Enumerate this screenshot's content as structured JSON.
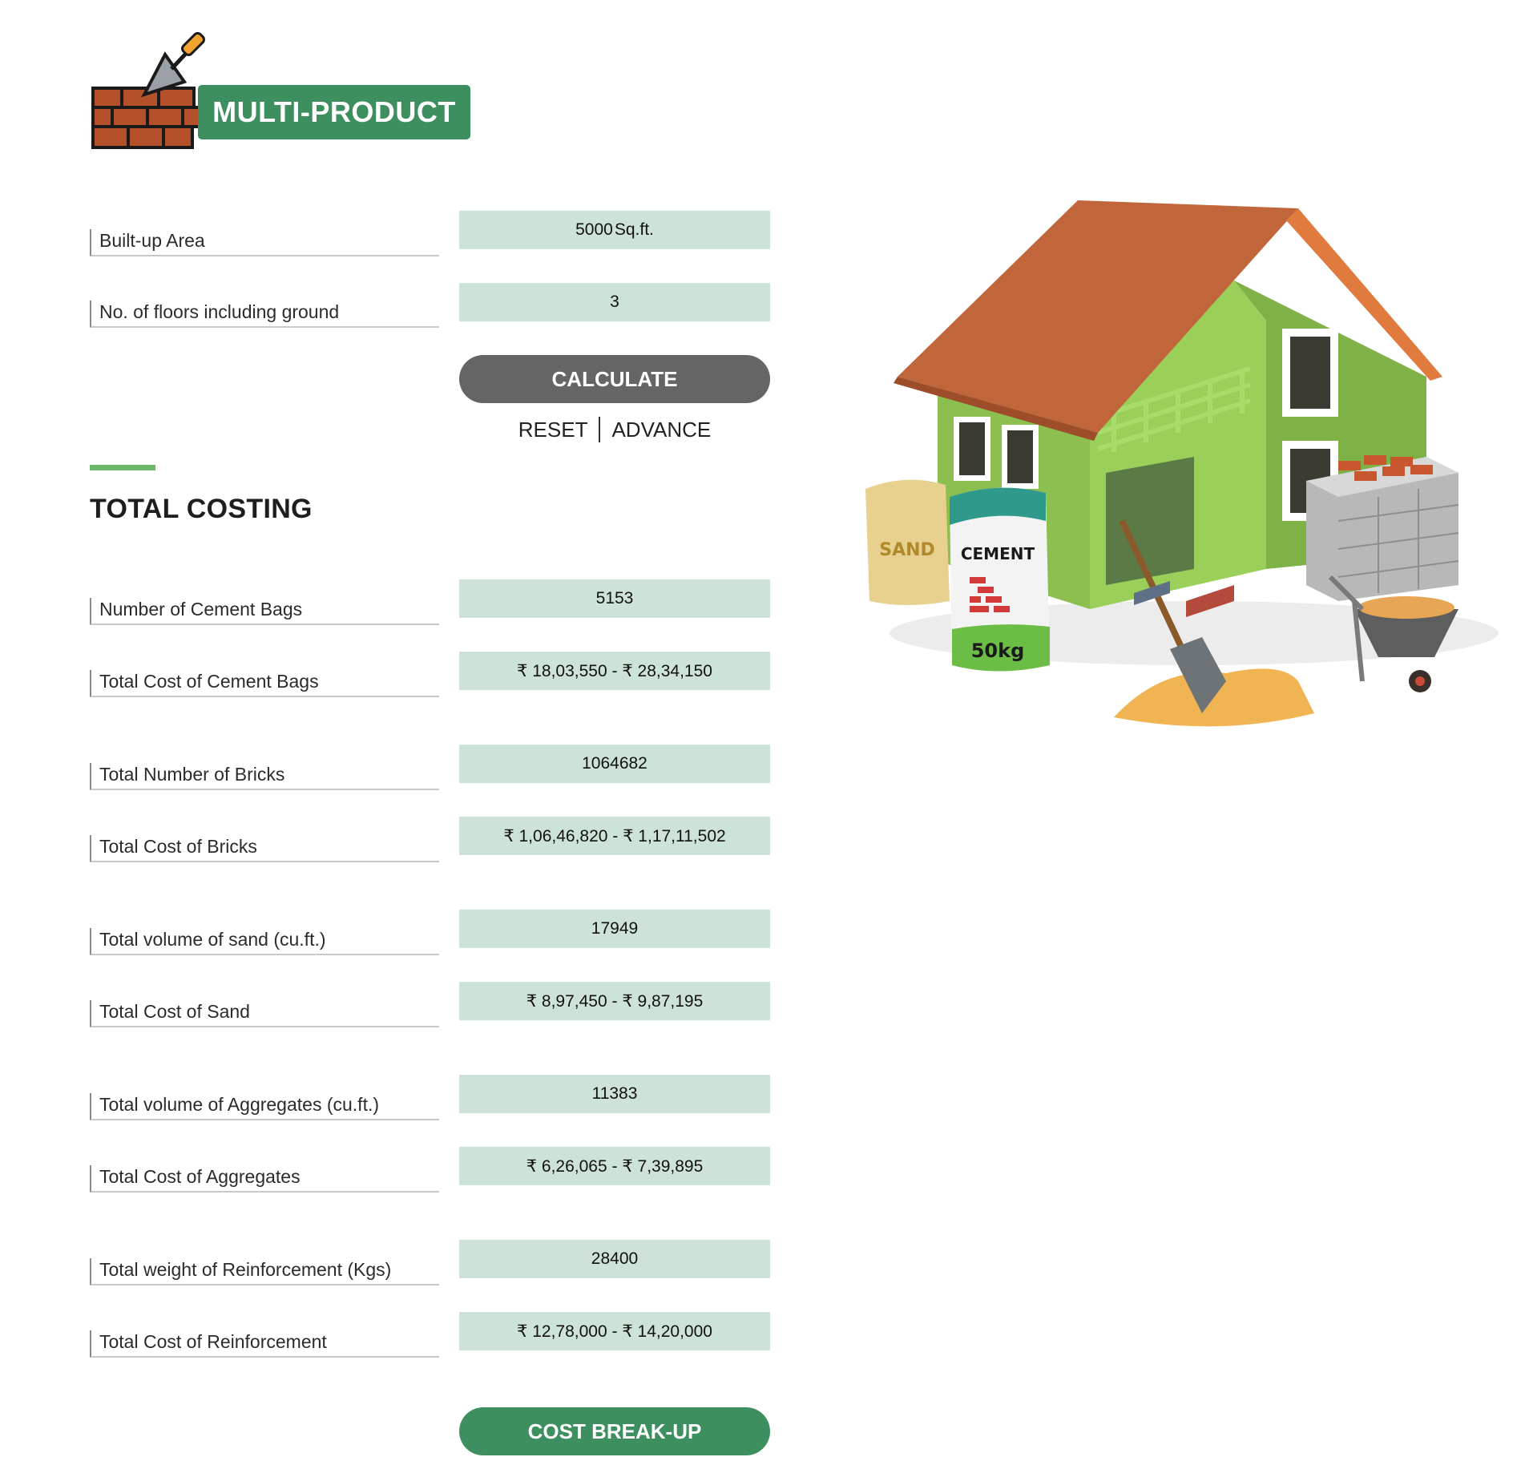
{
  "brand": {
    "logo_text": "MULTI-PRODUCT"
  },
  "inputs": {
    "built_up_area": {
      "label": "Built-up Area",
      "value": "5000",
      "unit": "Sq.ft."
    },
    "floors": {
      "label": "No. of floors including ground",
      "value": "3"
    }
  },
  "actions": {
    "calculate": "CALCULATE",
    "reset": "RESET",
    "advance": "ADVANCE",
    "cost_breakup": "COST BREAK-UP"
  },
  "results": {
    "heading": "TOTAL COSTING",
    "rows": [
      {
        "label": "Number of Cement Bags",
        "value": "5153"
      },
      {
        "label": "Total Cost of Cement Bags",
        "value": "₹ 18,03,550 - ₹ 28,34,150"
      },
      {
        "label": "Total Number of Bricks",
        "value": "1064682"
      },
      {
        "label": "Total Cost of Bricks",
        "value": "₹ 1,06,46,820 - ₹ 1,17,11,502"
      },
      {
        "label": "Total volume of sand (cu.ft.)",
        "value": "17949"
      },
      {
        "label": "Total Cost of Sand",
        "value": "₹ 8,97,450 - ₹ 9,87,195"
      },
      {
        "label": "Total volume of Aggregates (cu.ft.)",
        "value": "11383"
      },
      {
        "label": "Total Cost of Aggregates",
        "value": "₹ 6,26,065 - ₹ 7,39,895"
      },
      {
        "label": "Total weight of Reinforcement (Kgs)",
        "value": "28400"
      },
      {
        "label": "Total Cost of Reinforcement",
        "value": "₹ 12,78,000 - ₹ 14,20,000"
      }
    ]
  },
  "illustration": {
    "sand_bag_text": "SAND",
    "cement_bag_text": "CEMENT",
    "cement_weight": "50kg"
  },
  "colors": {
    "brand_green": "#3e8f5f",
    "field_bg": "#cde3d8",
    "calc_button": "#656565",
    "accent_bar": "#69b86b"
  }
}
